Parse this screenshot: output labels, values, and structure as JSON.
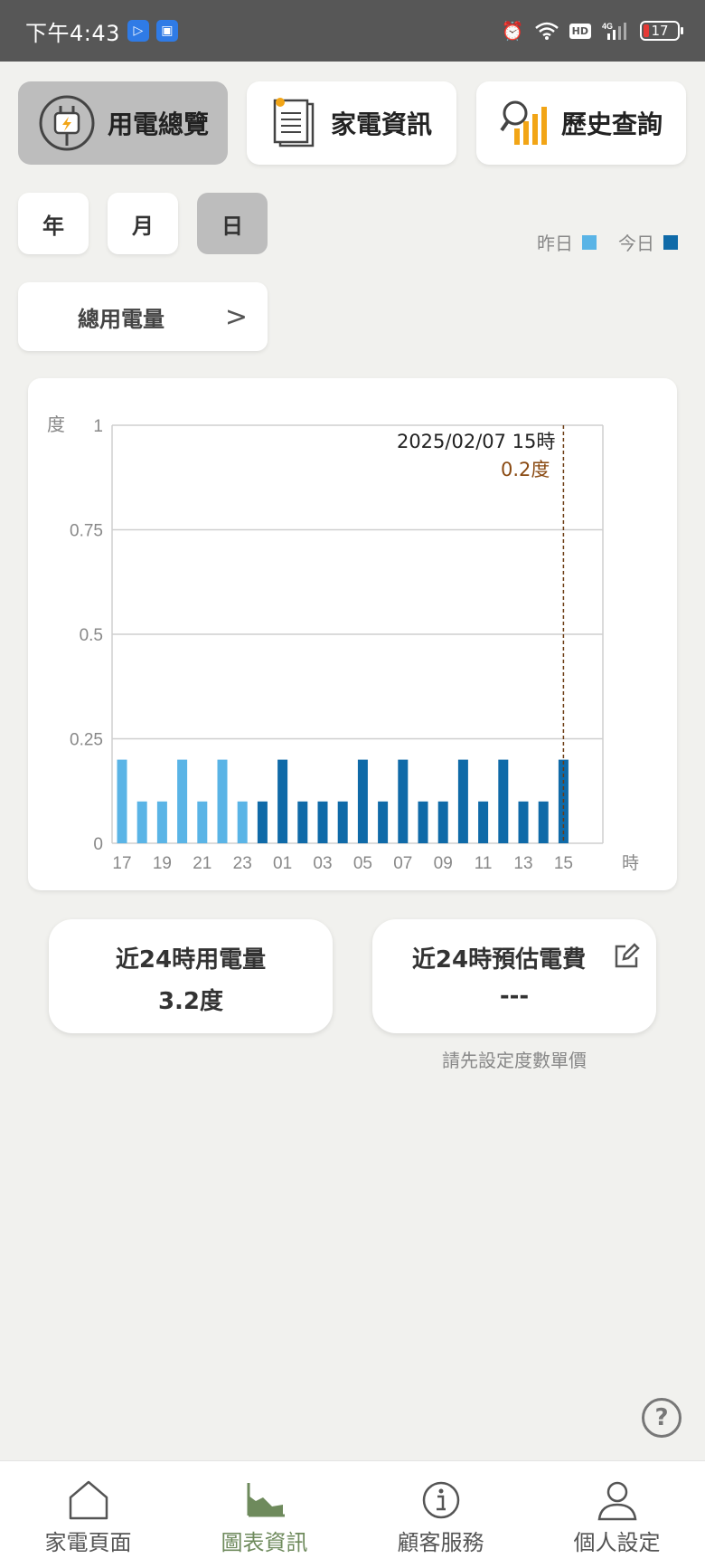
{
  "status_bar": {
    "time": "下午4:43",
    "battery": "17"
  },
  "tabs": [
    {
      "label": "用電總覽",
      "active": true
    },
    {
      "label": "家電資訊",
      "active": false
    },
    {
      "label": "歷史查詢",
      "active": false
    }
  ],
  "periods": [
    {
      "label": "年",
      "active": false
    },
    {
      "label": "月",
      "active": false
    },
    {
      "label": "日",
      "active": true
    }
  ],
  "legend": {
    "yesterday": "昨日",
    "today": "今日",
    "yesterday_color": "#5ab4e6",
    "today_color": "#0f6aa8"
  },
  "selector": {
    "label": "總用電量",
    "chevron": ">"
  },
  "chart_data": {
    "type": "bar",
    "ylabel": "度",
    "xlabel": "時",
    "ylim": [
      0,
      1
    ],
    "yticks": [
      "0",
      "0.25",
      "0.5",
      "0.75",
      "1"
    ],
    "categories": [
      "17",
      "18",
      "19",
      "20",
      "21",
      "22",
      "23",
      "00",
      "01",
      "02",
      "03",
      "04",
      "05",
      "06",
      "07",
      "08",
      "09",
      "10",
      "11",
      "12",
      "13",
      "14",
      "15"
    ],
    "xtick_labels": [
      "17",
      "19",
      "21",
      "23",
      "01",
      "03",
      "05",
      "07",
      "09",
      "11",
      "13",
      "15"
    ],
    "values": [
      0.2,
      0.1,
      0.1,
      0.2,
      0.1,
      0.2,
      0.1,
      0.1,
      0.2,
      0.1,
      0.1,
      0.1,
      0.2,
      0.1,
      0.2,
      0.1,
      0.1,
      0.2,
      0.1,
      0.2,
      0.1,
      0.1,
      0.2
    ],
    "series_day": [
      "yesterday",
      "yesterday",
      "yesterday",
      "yesterday",
      "yesterday",
      "yesterday",
      "yesterday",
      "today",
      "today",
      "today",
      "today",
      "today",
      "today",
      "today",
      "today",
      "today",
      "today",
      "today",
      "today",
      "today",
      "today",
      "today",
      "today"
    ],
    "grid": true,
    "tooltip": {
      "datetime": "2025/02/07 15時",
      "value": "0.2度",
      "index": 22
    }
  },
  "stats": {
    "usage_label": "近24時用電量",
    "usage_value": "3.2度",
    "cost_label": "近24時預估電費",
    "cost_value": "---",
    "cost_hint": "請先設定度數單價"
  },
  "help": "?",
  "nav": [
    {
      "label": "家電頁面",
      "icon": "home-icon",
      "active": false
    },
    {
      "label": "圖表資訊",
      "icon": "chart-icon",
      "active": true
    },
    {
      "label": "顧客服務",
      "icon": "info-icon",
      "active": false
    },
    {
      "label": "個人設定",
      "icon": "person-icon",
      "active": false
    }
  ]
}
